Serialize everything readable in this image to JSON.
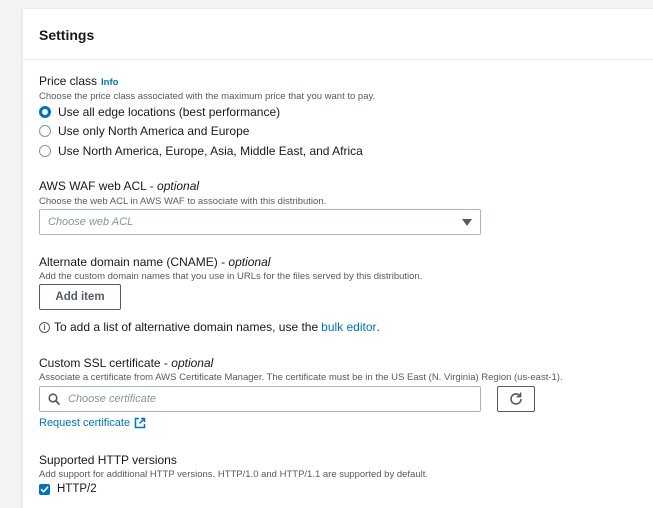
{
  "panel": {
    "title": "Settings"
  },
  "price_class": {
    "label": "Price class",
    "info": "Info",
    "description": "Choose the price class associated with the maximum price that you want to pay.",
    "options": [
      {
        "label": "Use all edge locations (best performance)",
        "checked": true
      },
      {
        "label": "Use only North America and Europe",
        "checked": false
      },
      {
        "label": "Use North America, Europe, Asia, Middle East, and Africa",
        "checked": false
      }
    ]
  },
  "waf": {
    "label": "AWS WAF web ACL - ",
    "optional": "optional",
    "description": "Choose the web ACL in AWS WAF to associate with this distribution.",
    "placeholder": "Choose web ACL"
  },
  "cname": {
    "label": "Alternate domain name (CNAME) - ",
    "optional": "optional",
    "description": "Add the custom domain names that you use in URLs for the files served by this distribution.",
    "add_button": "Add item",
    "note_prefix": "To add a list of alternative domain names, use the ",
    "note_link": "bulk editor",
    "note_suffix": "."
  },
  "ssl": {
    "label": "Custom SSL certificate - ",
    "optional": "optional",
    "description": "Associate a certificate from AWS Certificate Manager. The certificate must be in the US East (N. Virginia) Region (us-east-1).",
    "placeholder": "Choose certificate",
    "request_link": "Request certificate"
  },
  "http": {
    "label": "Supported HTTP versions",
    "description": "Add support for additional HTTP versions. HTTP/1.0 and HTTP/1.1 are supported by default.",
    "options": [
      {
        "label": "HTTP/2",
        "checked": true
      }
    ]
  },
  "colors": {
    "accent": "#0073bb",
    "text": "#16191f",
    "muted": "#545b64",
    "placeholder": "#879596"
  },
  "icons": {
    "info": "info-icon",
    "search": "search-icon",
    "refresh": "refresh-icon",
    "external": "external-link-icon",
    "caret": "caret-down-icon",
    "check": "check-icon"
  }
}
